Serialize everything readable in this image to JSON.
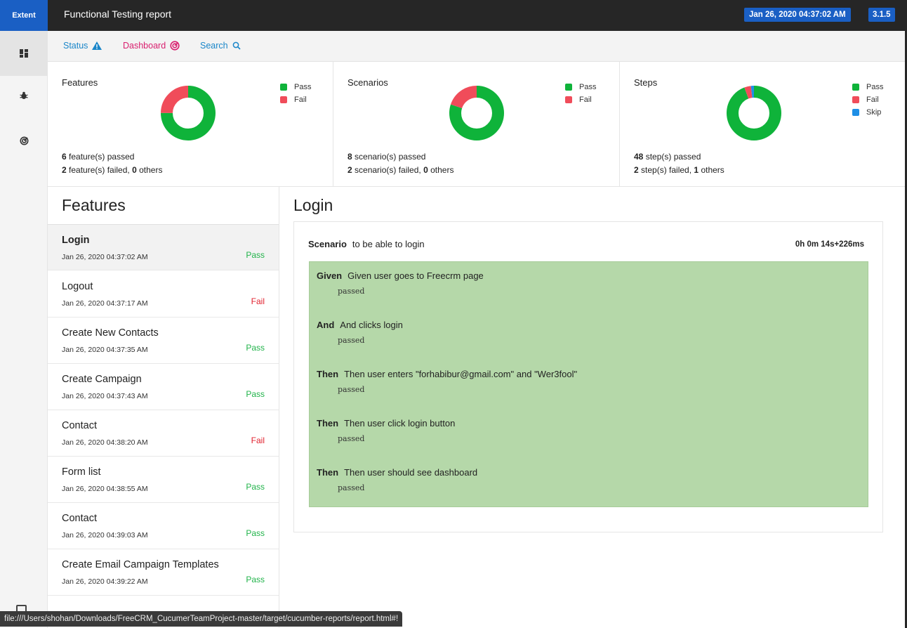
{
  "header": {
    "brand": "Extent",
    "title": "Functional Testing report",
    "date": "Jan 26, 2020 04:37:02 AM",
    "version": "3.1.5"
  },
  "sidebar": {
    "items": [
      {
        "icon": "dashboard-grid-icon"
      },
      {
        "icon": "bug-icon"
      },
      {
        "icon": "radar-icon"
      }
    ]
  },
  "nav": {
    "status": "Status",
    "dashboard": "Dashboard",
    "search": "Search"
  },
  "colors": {
    "pass": "#0fb33a",
    "fail": "#f04c5a",
    "skip": "#1e8fe6",
    "accent": "#1a5fc4"
  },
  "summary": [
    {
      "title": "Features",
      "legend": [
        "Pass",
        "Fail"
      ],
      "line1_num": "6",
      "line1_text": "feature(s) passed",
      "line2_num": "2",
      "line2_text": "feature(s) failed,",
      "line2_others": "0",
      "line2_suffix": "others",
      "values": {
        "pass": 6,
        "fail": 2,
        "skip": 0
      }
    },
    {
      "title": "Scenarios",
      "legend": [
        "Pass",
        "Fail"
      ],
      "line1_num": "8",
      "line1_text": "scenario(s) passed",
      "line2_num": "2",
      "line2_text": "scenario(s) failed,",
      "line2_others": "0",
      "line2_suffix": "others",
      "values": {
        "pass": 8,
        "fail": 2,
        "skip": 0
      }
    },
    {
      "title": "Steps",
      "legend": [
        "Pass",
        "Fail",
        "Skip"
      ],
      "line1_num": "48",
      "line1_text": "step(s) passed",
      "line2_num": "2",
      "line2_text": "step(s) failed,",
      "line2_others": "1",
      "line2_suffix": "others",
      "values": {
        "pass": 48,
        "fail": 2,
        "skip": 1
      }
    }
  ],
  "features": {
    "heading": "Features",
    "items": [
      {
        "name": "Login",
        "date": "Jan 26, 2020 04:37:02 AM",
        "status": "Pass"
      },
      {
        "name": "Logout",
        "date": "Jan 26, 2020 04:37:17 AM",
        "status": "Fail"
      },
      {
        "name": "Create New Contacts",
        "date": "Jan 26, 2020 04:37:35 AM",
        "status": "Pass"
      },
      {
        "name": "Create Campaign",
        "date": "Jan 26, 2020 04:37:43 AM",
        "status": "Pass"
      },
      {
        "name": "Contact",
        "date": "Jan 26, 2020 04:38:20 AM",
        "status": "Fail"
      },
      {
        "name": "Form list",
        "date": "Jan 26, 2020 04:38:55 AM",
        "status": "Pass"
      },
      {
        "name": "Contact",
        "date": "Jan 26, 2020 04:39:03 AM",
        "status": "Pass"
      },
      {
        "name": "Create Email Campaign Templates",
        "date": "Jan 26, 2020 04:39:22 AM",
        "status": "Pass"
      }
    ]
  },
  "detail": {
    "title": "Login",
    "scenario_keyword": "Scenario",
    "scenario_name": "to be able to login",
    "duration": "0h 0m 14s+226ms",
    "steps": [
      {
        "keyword": "Given",
        "text": "Given user goes to Freecrm page",
        "status": "passed"
      },
      {
        "keyword": "And",
        "text": "And clicks login",
        "status": "passed"
      },
      {
        "keyword": "Then",
        "text": "Then user enters \"forhabibur@gmail.com\" and \"Wer3fool\"",
        "status": "passed"
      },
      {
        "keyword": "Then",
        "text": "Then user click login button",
        "status": "passed"
      },
      {
        "keyword": "Then",
        "text": "Then user should see dashboard",
        "status": "passed"
      }
    ]
  },
  "statusbar": {
    "url": "file:///Users/shohan/Downloads/FreeCRM_CucumerTeamProject-master/target/cucumber-reports/report.html#!"
  }
}
